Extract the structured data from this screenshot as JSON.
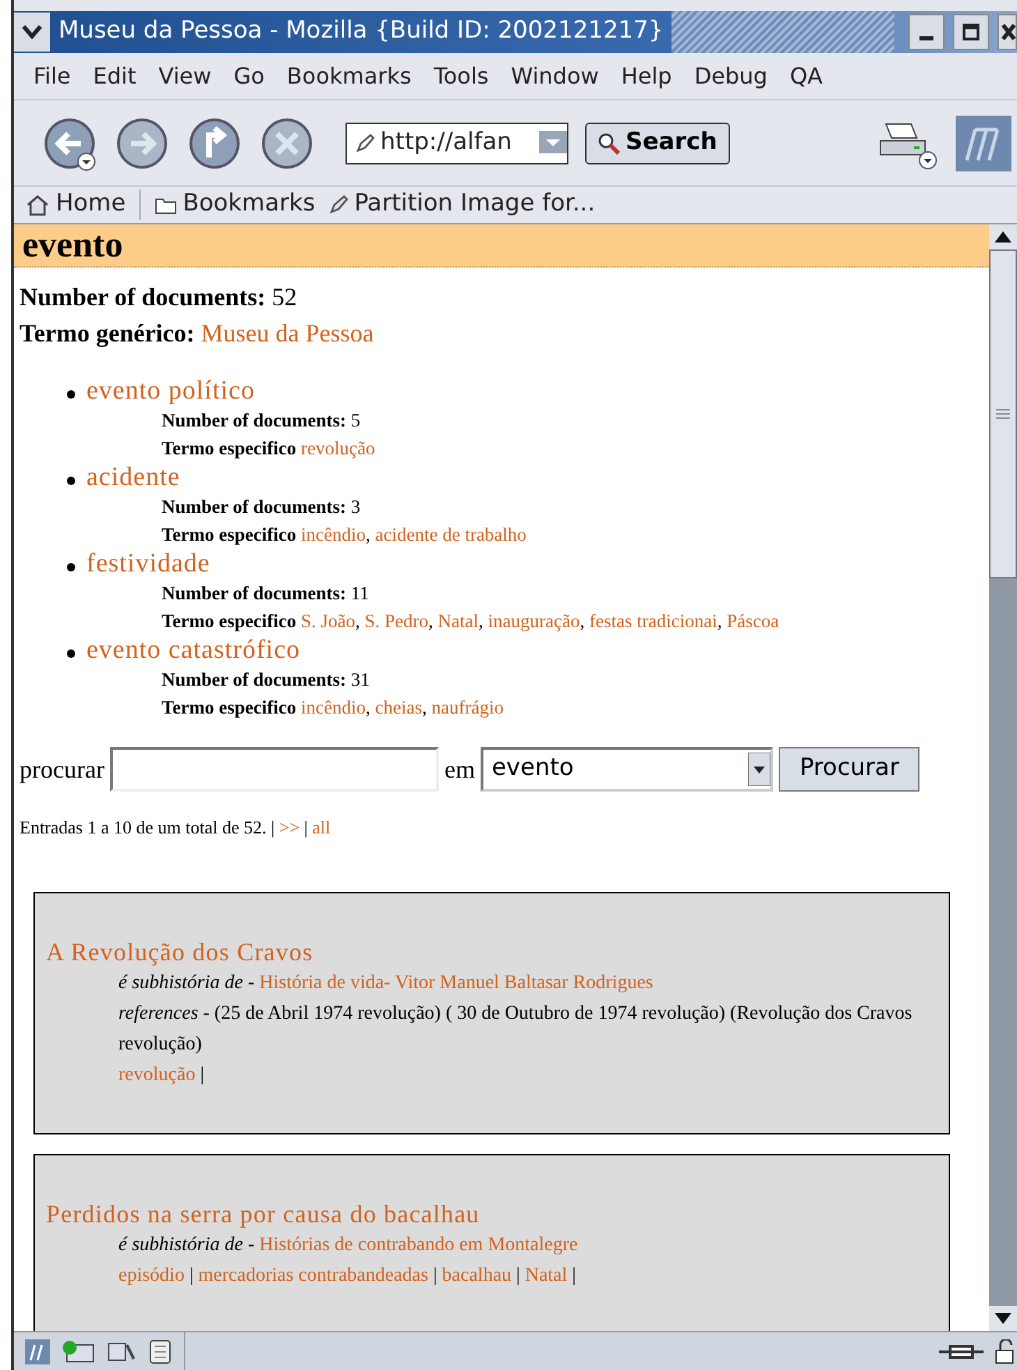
{
  "window": {
    "title": "Museu da Pessoa - Mozilla {Build ID: 2002121217}"
  },
  "menu": [
    "File",
    "Edit",
    "View",
    "Go",
    "Bookmarks",
    "Tools",
    "Window",
    "Help",
    "Debug",
    "QA"
  ],
  "toolbar": {
    "url": "http://alfan",
    "search_label": "Search"
  },
  "bookmarks_bar": {
    "home": "Home",
    "bookmarks": "Bookmarks",
    "item": "Partition Image for..."
  },
  "page": {
    "heading": "evento",
    "doc_count_label": "Number of documents:",
    "doc_count": "52",
    "generic_label": "Termo genérico:",
    "generic_link": "Museu da Pessoa",
    "terms": [
      {
        "name": "evento político",
        "count_label": "Number of documents:",
        "count": "5",
        "spec_label": "Termo especifico",
        "links": [
          "revolução"
        ]
      },
      {
        "name": "acidente",
        "count_label": "Number of documents:",
        "count": "3",
        "spec_label": "Termo especifico",
        "links": [
          "incêndio",
          "acidente de trabalho"
        ]
      },
      {
        "name": "festividade",
        "count_label": "Number of documents:",
        "count": "11",
        "spec_label": "Termo especifico",
        "links": [
          "S. João",
          "S. Pedro",
          "Natal",
          "inauguração",
          "festas tradicionai",
          "Páscoa"
        ]
      },
      {
        "name": "evento catastrófico",
        "count_label": "Number of documents:",
        "count": "31",
        "spec_label": "Termo especifico",
        "links": [
          "incêndio",
          "cheias",
          "naufrágio"
        ]
      }
    ],
    "link_separator": ",",
    "search": {
      "label": "procurar",
      "in_label": "em",
      "scope": "evento",
      "button": "Procurar"
    },
    "pagination": {
      "text": "Entradas 1 a 10 de um total de 52.",
      "separator": "|",
      "links": [
        ">>",
        "all"
      ]
    },
    "stories": [
      {
        "title": "A Revolução dos Cravos",
        "parent_prefix": "*é subhistória de* -",
        "parent_link": "História de vida- Vitor Manuel Baltasar Rodrigues",
        "references": "*references* - (25 de Abril 1974 revolução) ( 30 de Outubro de 1974 revolução) (Revolução dos Cravos revolução)",
        "tags": [
          "revolução"
        ]
      },
      {
        "title": "Perdidos na serra por causa do bacalhau",
        "parent_prefix": "*é subhistória de* -",
        "parent_link": "Histórias de contrabando em Montalegre",
        "tags": [
          "episódio",
          "mercadorias contrabandeadas",
          "bacalhau",
          "Natal"
        ]
      }
    ],
    "tag_separator": "|"
  }
}
